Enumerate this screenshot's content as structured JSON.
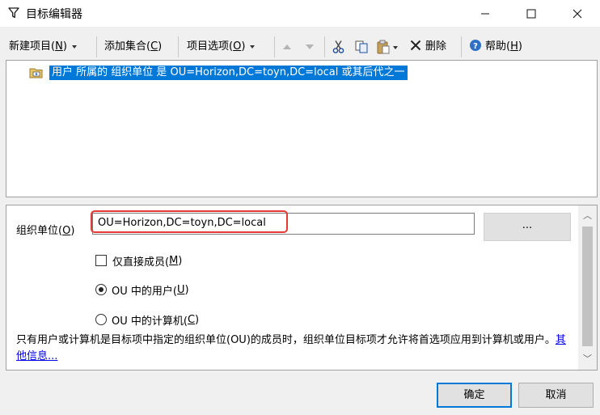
{
  "window": {
    "title": "目标编辑器",
    "icon": "funnel-icon",
    "controls": [
      "minimize-icon",
      "maximize-icon",
      "close-icon"
    ]
  },
  "toolbar": {
    "new_item": {
      "label": "新建项目(",
      "accel": "N",
      "close": ")"
    },
    "add_collection": {
      "label": "添加集合(",
      "accel": "C",
      "close": ")"
    },
    "item_options": {
      "label": "项目选项(",
      "accel": "O",
      "close": ")"
    },
    "delete_label": "删除",
    "help": {
      "label": "帮助(",
      "accel": "H",
      "close": ")"
    },
    "icons": [
      "move-up-icon",
      "move-down-icon",
      "cut-icon",
      "copy-icon",
      "paste-icon",
      "delete-x-icon",
      "help-icon"
    ]
  },
  "list": {
    "items": [
      {
        "text": "用户 所属的 组织单位 是 OU=Horizon,DC=toyn,DC=local 或其后代之一",
        "selected": true,
        "icon": "folder-icon"
      }
    ]
  },
  "properties": {
    "ou_label": {
      "label": "组织单位(",
      "accel": "O",
      "close": ")"
    },
    "ou_value": "OU=Horizon,DC=toyn,DC=local",
    "browse_label": "...",
    "direct_members": {
      "label": "仅直接成员(",
      "accel": "M",
      "close": ")",
      "checked": false
    },
    "users_in_ou": {
      "label": "OU 中的用户(",
      "accel": "U",
      "close": ")",
      "selected": true
    },
    "computers_in_ou": {
      "label": "OU 中的计算机(",
      "accel": "C",
      "close": ")",
      "selected": false
    },
    "info_text": "只有用户或计算机是目标项中指定的组织单位(OU)的成员时，组织单位目标项才允许将首选项应用到计算机或用户。",
    "info_link": "其他信息..."
  },
  "buttons": {
    "ok": "确定",
    "cancel": "取消"
  },
  "colors": {
    "selection": "#0078d7",
    "highlight_box": "#e53935",
    "link": "#0000ee"
  }
}
